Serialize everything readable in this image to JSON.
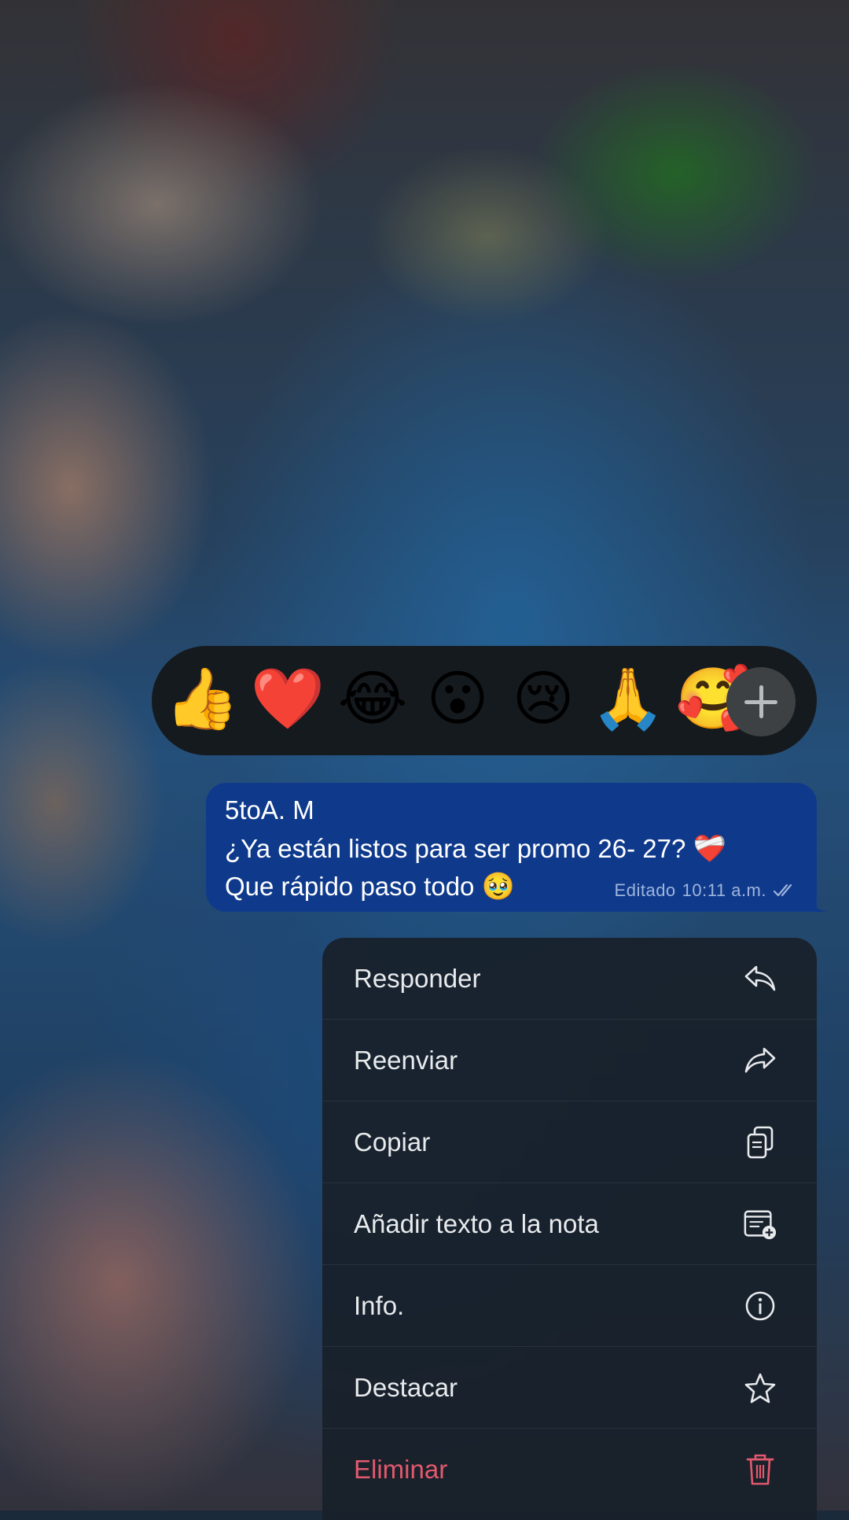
{
  "reactions": {
    "emojis": [
      "👍",
      "❤️",
      "😂",
      "😮",
      "😢",
      "🙏",
      "🥰"
    ],
    "more_icon": "plus-icon"
  },
  "message": {
    "sender": "5toA. M",
    "line1": "¿Ya están listos para ser promo 26- 27?",
    "line1_emoji": "❤️‍🩹",
    "line2": "Que rápido paso todo",
    "line2_emoji": "🥹",
    "meta_edited": "Editado",
    "meta_time": "10:11 a.m.",
    "status_icon": "double-check-icon"
  },
  "menu": {
    "items": [
      {
        "label": "Responder",
        "icon": "reply-icon"
      },
      {
        "label": "Reenviar",
        "icon": "forward-icon"
      },
      {
        "label": "Copiar",
        "icon": "copy-icon"
      },
      {
        "label": "Añadir texto a la nota",
        "icon": "add-note-icon"
      },
      {
        "label": "Info.",
        "icon": "info-icon"
      },
      {
        "label": "Destacar",
        "icon": "star-icon"
      },
      {
        "label": "Eliminar",
        "icon": "trash-icon"
      }
    ]
  },
  "colors": {
    "bubble": "#0f3a8c",
    "menu_bg": "#18202a",
    "danger": "#e2596e",
    "reaction_bar": "#151a1e"
  }
}
